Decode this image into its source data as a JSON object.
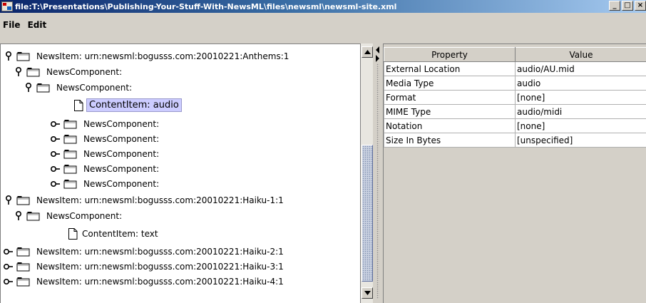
{
  "window": {
    "title": "file:T:\\Presentations\\Publishing-Your-Stuff-With-NewsML\\files\\newsml\\newsml-site.xml",
    "minimize_label": "_",
    "maximize_label": "□",
    "close_label": "×"
  },
  "menu": {
    "items": [
      "File",
      "Edit"
    ]
  },
  "tree": {
    "nodes": [
      {
        "label": "NewsItem: urn:newsml:bogusss.com:20010221:Anthems:1",
        "state": "expanded",
        "icon": "folder-icon"
      },
      {
        "label": "NewsComponent:",
        "state": "expanded",
        "icon": "folder-icon"
      },
      {
        "label": "NewsComponent:",
        "state": "expanded",
        "icon": "folder-icon"
      },
      {
        "label": "ContentItem: audio",
        "state": "leaf",
        "icon": "document-icon",
        "selected": true
      },
      {
        "label": "NewsComponent:",
        "state": "collapsed",
        "icon": "folder-icon"
      },
      {
        "label": "NewsComponent:",
        "state": "collapsed",
        "icon": "folder-icon"
      },
      {
        "label": "NewsComponent:",
        "state": "collapsed",
        "icon": "folder-icon"
      },
      {
        "label": "NewsComponent:",
        "state": "collapsed",
        "icon": "folder-icon"
      },
      {
        "label": "NewsComponent:",
        "state": "collapsed",
        "icon": "folder-icon"
      },
      {
        "label": "NewsItem: urn:newsml:bogusss.com:20010221:Haiku-1:1",
        "state": "expanded",
        "icon": "folder-icon"
      },
      {
        "label": "NewsComponent:",
        "state": "expanded",
        "icon": "folder-icon"
      },
      {
        "label": "ContentItem: text",
        "state": "leaf",
        "icon": "document-icon"
      },
      {
        "label": "NewsItem: urn:newsml:bogusss.com:20010221:Haiku-2:1",
        "state": "collapsed",
        "icon": "folder-icon"
      },
      {
        "label": "NewsItem: urn:newsml:bogusss.com:20010221:Haiku-3:1",
        "state": "collapsed",
        "icon": "folder-icon"
      },
      {
        "label": "NewsItem: urn:newsml:bogusss.com:20010221:Haiku-4:1",
        "state": "collapsed",
        "icon": "folder-icon"
      }
    ]
  },
  "properties": {
    "headers": [
      "Property",
      "Value"
    ],
    "rows": [
      [
        "External Location",
        "audio/AU.mid"
      ],
      [
        "Media Type",
        "audio"
      ],
      [
        "Format",
        "[none]"
      ],
      [
        "MIME Type",
        "audio/midi"
      ],
      [
        "Notation",
        "[none]"
      ],
      [
        "Size In Bytes",
        "[unspecified]"
      ]
    ]
  },
  "colors": {
    "selection": "#ccccff",
    "titlebar": "#0a246a",
    "window_background": "#d4d0c8"
  }
}
